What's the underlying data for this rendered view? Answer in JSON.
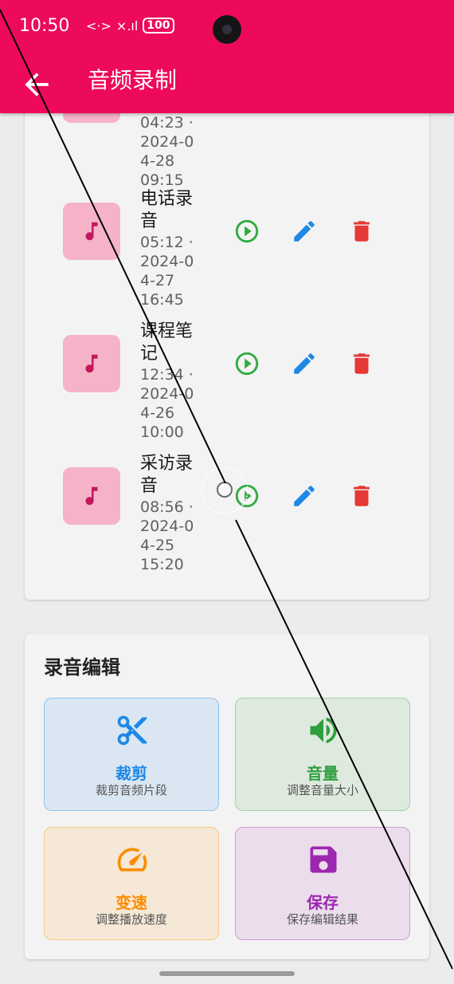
{
  "status_bar": {
    "time": "10:50",
    "data_icon": "<·>",
    "signal_icon": "×.ıl",
    "battery": "100"
  },
  "app_bar": {
    "title": "音频录制",
    "back_icon": "arrow-back-icon"
  },
  "recordings": [
    {
      "title": "",
      "meta": [
        "04:23 ·",
        "2024-0",
        "4-28",
        "09:15"
      ]
    },
    {
      "title": "电话录音",
      "title_lines": [
        "电话录",
        "音"
      ],
      "meta": [
        "05:12 ·",
        "2024-0",
        "4-27",
        "16:45"
      ]
    },
    {
      "title": "课程笔记",
      "title_lines": [
        "课程笔",
        "记"
      ],
      "meta": [
        "12:34 ·",
        "2024-0",
        "4-26",
        "10:00"
      ]
    },
    {
      "title": "采访录音",
      "title_lines": [
        "采访录",
        "音"
      ],
      "meta": [
        "08:56 ·",
        "2024-0",
        "4-25",
        "15:20"
      ]
    }
  ],
  "edit": {
    "title": "录音编辑",
    "tiles": [
      {
        "name": "裁剪",
        "desc": "裁剪音频片段",
        "color": "#1e88e5",
        "icon": "scissors-icon"
      },
      {
        "name": "音量",
        "desc": "调整音量大小",
        "color": "#2e9e3e",
        "icon": "volume-icon"
      },
      {
        "name": "变速",
        "desc": "调整播放速度",
        "color": "#fb8c00",
        "icon": "speedometer-icon"
      },
      {
        "name": "保存",
        "desc": "保存编辑结果",
        "color": "#9c27b0",
        "icon": "save-icon"
      }
    ]
  },
  "colors": {
    "primary": "#ee0a5a",
    "play": "#2eaa3e",
    "edit": "#1e88e5",
    "delete": "#e53935",
    "thumb": "#f6b3c8",
    "note": "#c2185b"
  }
}
